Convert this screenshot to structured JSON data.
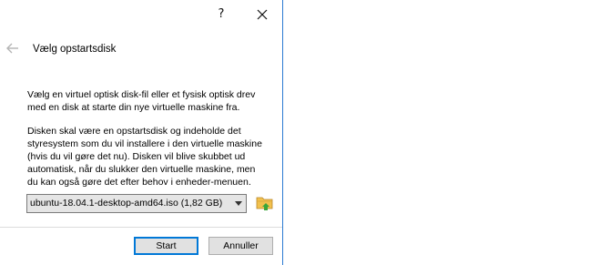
{
  "titlebar": {
    "help_label": "?",
    "help_icon": "question-mark-icon",
    "close_icon": "close-icon"
  },
  "header": {
    "back_icon": "back-arrow-icon",
    "title": "Vælg opstartsdisk"
  },
  "body": {
    "paragraph_1": "Vælg en virtuel optisk disk-fil eller et fysisk optisk drev\nmed en disk at starte din nye virtuelle maskine fra.",
    "paragraph_2": "Disken skal være en opstartsdisk og indeholde det\nstyresystem som du vil installere i den virtuelle maskine\n(hvis du vil gøre det nu). Disken vil blive skubbet ud\nautomatisk, når du slukker den virtuelle maskine, men\ndu kan også gøre det efter behov i enheder-menuen."
  },
  "disk_selector": {
    "selected_value": "ubuntu-18.04.1-desktop-amd64.iso (1,82 GB)",
    "dropdown_icon": "chevron-down-icon",
    "browse_icon": "folder-browse-icon"
  },
  "buttons": {
    "start_label": "Start",
    "cancel_label": "Annuller"
  },
  "colors": {
    "window_border": "#2b7bd2",
    "default_button_border": "#0078d7",
    "button_face": "#e1e1e1",
    "folder_yellow": "#f2c14e",
    "folder_green_arrow": "#3aa63a"
  }
}
